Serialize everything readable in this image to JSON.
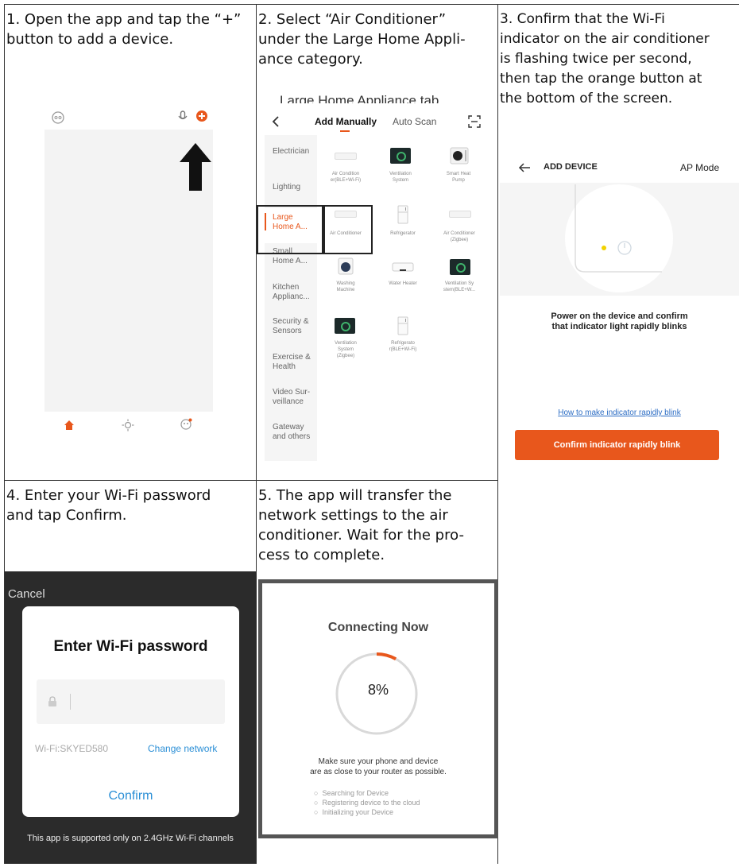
{
  "captions": {
    "step1": [
      "1. Open the app and tap the “+”",
      "button to add a device."
    ],
    "step2": [
      "2. Select “Air Conditioner”",
      "under the Large Home Appli-",
      "ance category."
    ],
    "step3": [
      "3. Confirm that the Wi-Fi",
      "indicator on the air conditioner",
      "is flashing twice per second,",
      "then tap the orange button at",
      "the bottom of the screen."
    ],
    "step4": [
      "4. Enter your Wi-Fi password",
      "and tap Confirm."
    ],
    "step5": [
      "5. The app will transfer the",
      "network settings to the air",
      "conditioner. Wait for the pro-",
      "cess to complete."
    ]
  },
  "step2_screen": {
    "clipped_heading": "Large Home Appliance tab.",
    "tab_manual": "Add Manually",
    "tab_auto": "Auto Scan",
    "categories": [
      "Electrician",
      "Lighting",
      "Large\nHome A...",
      "Small\nHome A...",
      "Kitchen\nApplianc...",
      "Security &\nSensors",
      "Exercise &\nHealth",
      "Video Sur-\nveillance",
      "Gateway\nand others"
    ],
    "devices": [
      "Air Condition\ner(BLE+Wi-Fi)",
      "Ventilation\nSystem",
      "Smart Heat\nPump",
      "Air Conditioner",
      "Refrigerator",
      "Air Conditioner\n(Zigbee)",
      "Washing\nMachine",
      "Water Heater",
      "Ventilation Sy\nstem(BLE+W...",
      "Ventilation\nSystem\n(Zigbee)",
      "Refrigerato\nr(BLE+Wi-Fi)"
    ]
  },
  "step3_screen": {
    "title": "ADD DEVICE",
    "mode": "AP Mode",
    "instruction": [
      "Power on the device and confirm",
      "that indicator light rapidly blinks"
    ],
    "help_link": "How to make indicator rapidly blink",
    "confirm_button": "Confirm indicator rapidly blink"
  },
  "step4_screen": {
    "cancel": "Cancel",
    "title": "Enter Wi-Fi password",
    "wifi_name": "Wi-Fi:SKYED580",
    "change_network": "Change network",
    "confirm": "Confirm",
    "footer": "This app is supported only on 2.4GHz Wi-Fi channels"
  },
  "step5_screen": {
    "title": "Connecting Now",
    "progress_label": "8%",
    "progress_value": 0.08,
    "note": [
      "Make sure your phone and device",
      "are as close to your router as possible."
    ],
    "steps": [
      "Searching for Device",
      "Registering device to the cloud",
      "Initializing your Device"
    ]
  },
  "colors": {
    "accent": "#e8571c",
    "link": "#2b6cc4",
    "highlight_box": "#222222"
  }
}
